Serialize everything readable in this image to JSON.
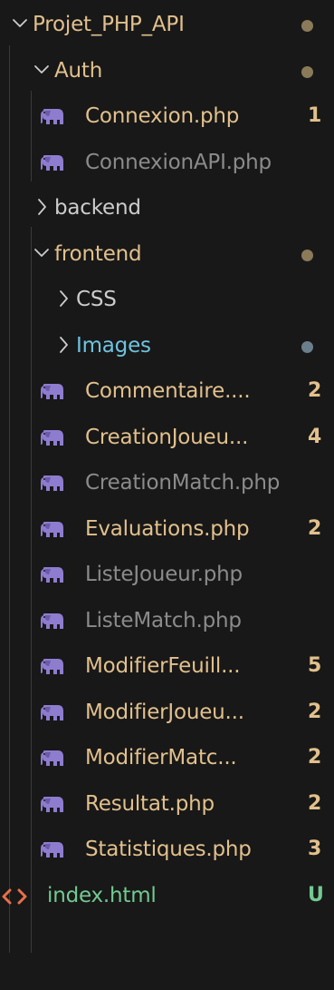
{
  "colors": {
    "background": "#181818",
    "folder_text": "#cccccc",
    "warning_text": "#e2c08d",
    "untracked_text": "#73c991",
    "muted_text": "#8b8b8b",
    "php_icon": "#8e7ccf",
    "dot_modified": "#8a7a5a",
    "dot_untracked": "#6a7e8c",
    "html_icon": "#e8704a",
    "images_text": "#6fc3df"
  },
  "tree": [
    {
      "kind": "folder",
      "label": "Projet_PHP_API",
      "expanded": true,
      "dot": "modified",
      "tone": "warning_text"
    },
    {
      "kind": "folder",
      "label": "Auth",
      "expanded": true,
      "dot": "modified",
      "tone": "warning_text"
    },
    {
      "kind": "file",
      "icon": "php-elephant-icon",
      "label": "Connexion.php",
      "badge": "1",
      "tone": "warning_text"
    },
    {
      "kind": "file",
      "icon": "php-elephant-icon",
      "label": "ConnexionAPI.php",
      "tone": "muted_text"
    },
    {
      "kind": "folder",
      "label": "backend",
      "expanded": false,
      "tone": "muted_text"
    },
    {
      "kind": "folder",
      "label": "frontend",
      "expanded": true,
      "dot": "modified",
      "tone": "warning_text"
    },
    {
      "kind": "folder",
      "label": "CSS",
      "expanded": false,
      "tone": "muted_text"
    },
    {
      "kind": "folder",
      "label": "Images",
      "expanded": false,
      "dot": "untracked",
      "tone": "images_text"
    },
    {
      "kind": "file",
      "icon": "php-elephant-icon",
      "label": "Commentaire....",
      "badge": "2",
      "tone": "warning_text"
    },
    {
      "kind": "file",
      "icon": "php-elephant-icon",
      "label": "CreationJoueu...",
      "badge": "4",
      "tone": "warning_text"
    },
    {
      "kind": "file",
      "icon": "php-elephant-icon",
      "label": "CreationMatch.php",
      "tone": "muted_text"
    },
    {
      "kind": "file",
      "icon": "php-elephant-icon",
      "label": "Evaluations.php",
      "badge": "2",
      "tone": "warning_text"
    },
    {
      "kind": "file",
      "icon": "php-elephant-icon",
      "label": "ListeJoueur.php",
      "tone": "muted_text"
    },
    {
      "kind": "file",
      "icon": "php-elephant-icon",
      "label": "ListeMatch.php",
      "tone": "muted_text"
    },
    {
      "kind": "file",
      "icon": "php-elephant-icon",
      "label": "ModifierFeuill...",
      "badge": "5",
      "tone": "warning_text"
    },
    {
      "kind": "file",
      "icon": "php-elephant-icon",
      "label": "ModifierJoueu...",
      "badge": "2",
      "tone": "warning_text"
    },
    {
      "kind": "file",
      "icon": "php-elephant-icon",
      "label": "ModifierMatc...",
      "badge": "2",
      "tone": "warning_text"
    },
    {
      "kind": "file",
      "icon": "php-elephant-icon",
      "label": "Resultat.php",
      "badge": "2",
      "tone": "warning_text"
    },
    {
      "kind": "file",
      "icon": "php-elephant-icon",
      "label": "Statistiques.php",
      "badge": "3",
      "tone": "warning_text"
    },
    {
      "kind": "file",
      "icon": "html-code-icon",
      "label": "index.html",
      "badge": "U",
      "tone": "untracked_text"
    }
  ]
}
